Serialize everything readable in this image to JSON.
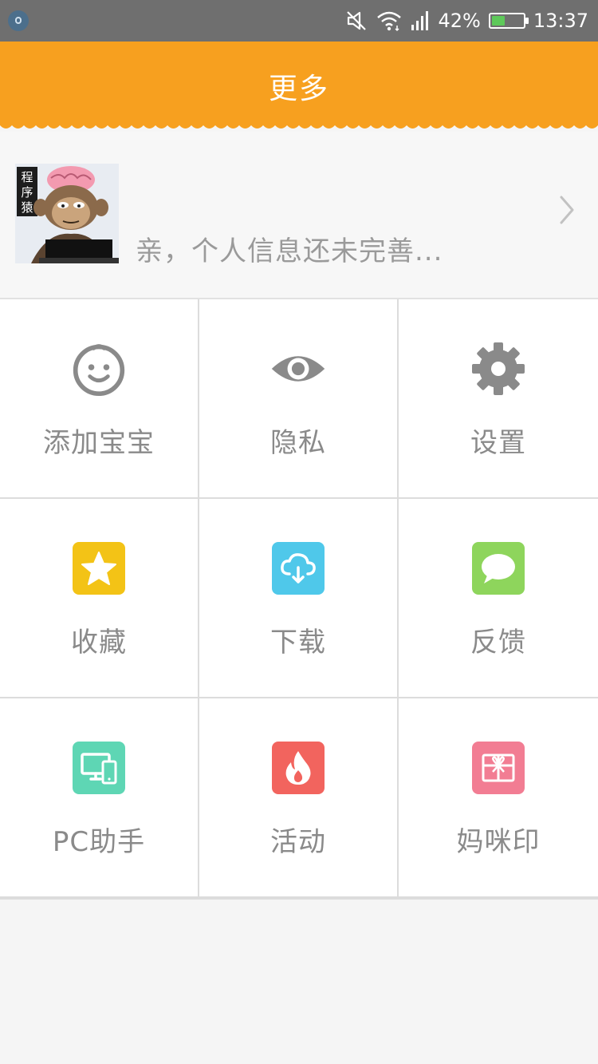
{
  "status_bar": {
    "battery_percent": "42%",
    "battery_level": 0.42,
    "time": "13:37",
    "icons": [
      "notification-icon",
      "mute-icon",
      "wifi-icon",
      "signal-icon",
      "battery-icon"
    ]
  },
  "header": {
    "title": "更多",
    "background_color": "#f7a01f"
  },
  "profile": {
    "prompt": "亲，个人信息还未完善...",
    "avatar_label": "程序猿"
  },
  "grid": {
    "items": [
      {
        "label": "添加宝宝",
        "icon": "baby-face-icon",
        "color": "#8a8a8a"
      },
      {
        "label": "隐私",
        "icon": "eye-icon",
        "color": "#8a8a8a"
      },
      {
        "label": "设置",
        "icon": "gear-icon",
        "color": "#8a8a8a"
      },
      {
        "label": "收藏",
        "icon": "star-icon",
        "color": "#f3c316"
      },
      {
        "label": "下载",
        "icon": "cloud-download-icon",
        "color": "#4fc8ea"
      },
      {
        "label": "反馈",
        "icon": "chat-bubble-icon",
        "color": "#8ed55c"
      },
      {
        "label": "PC助手",
        "icon": "pc-phone-icon",
        "color": "#5ed6b4"
      },
      {
        "label": "活动",
        "icon": "flame-icon",
        "color": "#f2645e"
      },
      {
        "label": "妈咪印",
        "icon": "gift-icon",
        "color": "#f27d93"
      }
    ]
  }
}
